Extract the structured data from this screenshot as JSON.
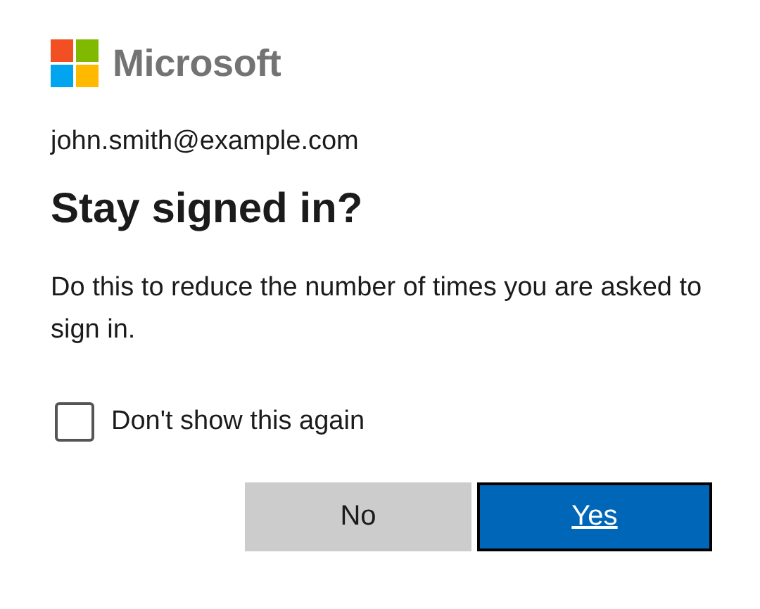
{
  "brand": {
    "name": "Microsoft"
  },
  "account": "john.smith@example.com",
  "title": "Stay signed in?",
  "description": "Do this to reduce the number of times you are asked to sign in.",
  "checkbox": {
    "label": "Don't show this again",
    "checked": false
  },
  "buttons": [
    {
      "label": "No",
      "kind": "secondary"
    },
    {
      "label": "Yes",
      "kind": "primary"
    }
  ]
}
